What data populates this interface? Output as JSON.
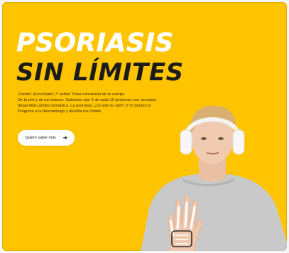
{
  "hero": {
    "title_line1": "PSORIASIS",
    "title_line2": "SIN LÍMITES",
    "description_lines": [
      "¡Siente! ¡Escúchate! ¡Y actúa! Toma conciencia de tu cuerpo.",
      "De tu piel y de tus huesos. Sabemos que 4 de cada 10 personas con psoriasis",
      "desarrollan artritis psoriásica. La psoriasis, ¿no solo es piel? ¡Y tú tampoco!",
      "Pregunta a tu dermatólogo y desafía tus límites"
    ],
    "cta_label": "Quiero saber más",
    "cta_icon": "arrow-right-icon"
  },
  "colors": {
    "background": "#ffc400",
    "title_light": "#ffffff",
    "title_dark": "#1b1b1b",
    "button_bg": "#ffffff"
  }
}
